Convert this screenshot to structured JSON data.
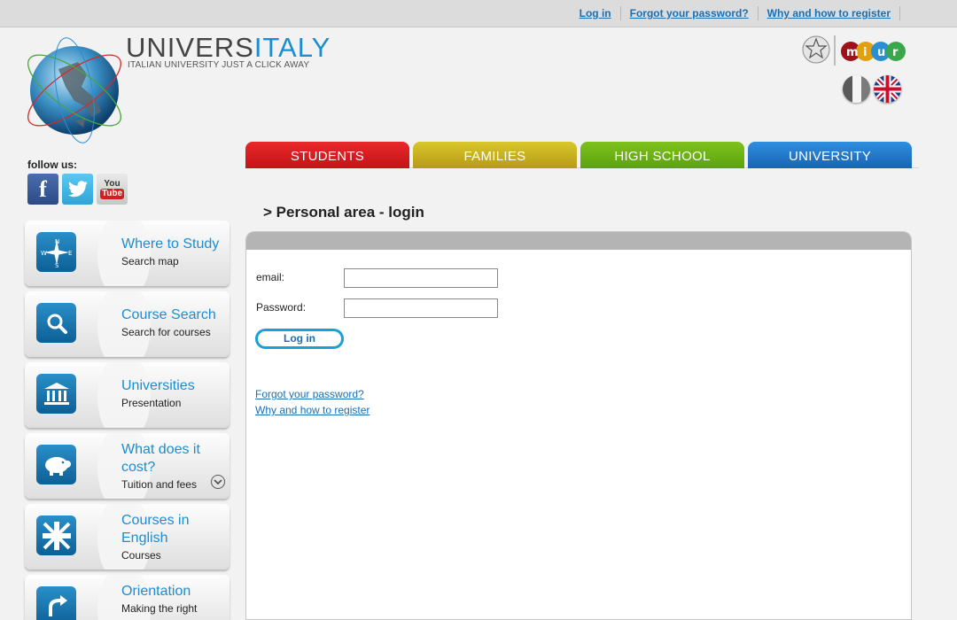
{
  "top_links": {
    "login": "Log in",
    "forgot": "Forgot your password?",
    "register": "Why and how to register"
  },
  "brand": {
    "name_part1": "UNIVERS",
    "name_part2": "ITALY",
    "tagline": "ITALIAN UNIVERSITY JUST A CLICK AWAY",
    "accent_color": "#1a8ed0"
  },
  "miur_logo_text": "miur",
  "tabs": [
    {
      "label": "STUDENTS",
      "color": "#d81c1f"
    },
    {
      "label": "FAMILIES",
      "color": "#c8b020"
    },
    {
      "label": "HIGH SCHOOL",
      "color": "#6cb216"
    },
    {
      "label": "UNIVERSITY",
      "color": "#2479cc"
    }
  ],
  "follow": {
    "label": "follow us:",
    "youtube_you": "You",
    "youtube_tube": "Tube"
  },
  "side_menu": [
    {
      "title": "Where to Study",
      "subtitle": "Search map",
      "icon": "compass-icon"
    },
    {
      "title": "Course Search",
      "subtitle": "Search for courses",
      "icon": "magnifier-icon"
    },
    {
      "title": "Universities",
      "subtitle": "Presentation",
      "icon": "building-icon"
    },
    {
      "title": "What does it cost?",
      "subtitle": "Tuition and fees",
      "icon": "piggy-bank-icon"
    },
    {
      "title": "Courses in English",
      "subtitle": "Courses",
      "icon": "union-jack-icon"
    },
    {
      "title": "Orientation",
      "subtitle": "Making the right",
      "icon": "arrow-icon"
    }
  ],
  "main": {
    "heading": "> Personal area - login",
    "email_label": "email:",
    "email_value": "",
    "password_label": "Password:",
    "password_value": "",
    "login_button": "Log in",
    "forgot_link": "Forgot your password?",
    "register_link": "Why and how to register"
  }
}
